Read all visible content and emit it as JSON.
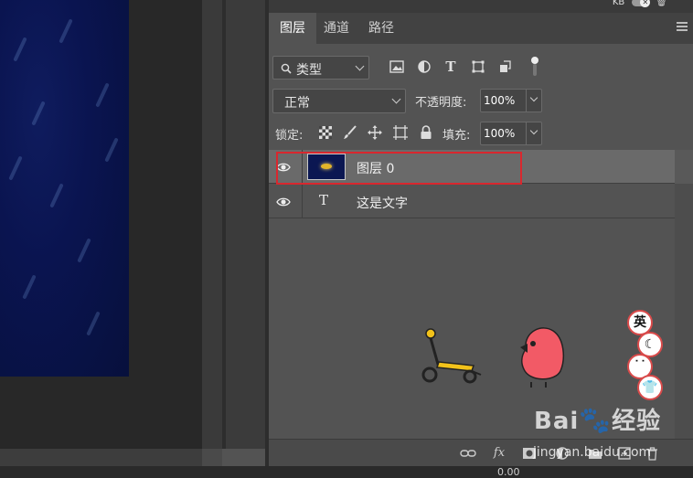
{
  "tabs": [
    {
      "label": "图层",
      "active": true
    },
    {
      "label": "通道",
      "active": false
    },
    {
      "label": "路径",
      "active": false
    }
  ],
  "filter": {
    "kind_label": "类型"
  },
  "blend": {
    "mode": "正常",
    "opacity_label": "不透明度:",
    "opacity_value": "100%"
  },
  "lock": {
    "label": "锁定:",
    "fill_label": "填充:",
    "fill_value": "100%"
  },
  "layers": [
    {
      "name": "图层 0",
      "type": "image",
      "visible": true,
      "selected": true
    },
    {
      "name": "这是文字",
      "type": "text",
      "visible": true,
      "selected": false
    }
  ],
  "footer": {
    "fx_label": "fx"
  },
  "topbar": {
    "label": "KB"
  },
  "status": {
    "text": "0.00"
  },
  "watermark": {
    "brand": "Bai",
    "brand_suffix": "经验",
    "sub": "jingyan.baidu.com"
  },
  "stickers": {
    "badge1": "英",
    "badge2": "☾",
    "badge3": "˙˙",
    "badge4": "👕"
  },
  "colors": {
    "panel_bg": "#535353",
    "highlight_border": "#d9272e",
    "canvas_blue": "#0a1450"
  }
}
